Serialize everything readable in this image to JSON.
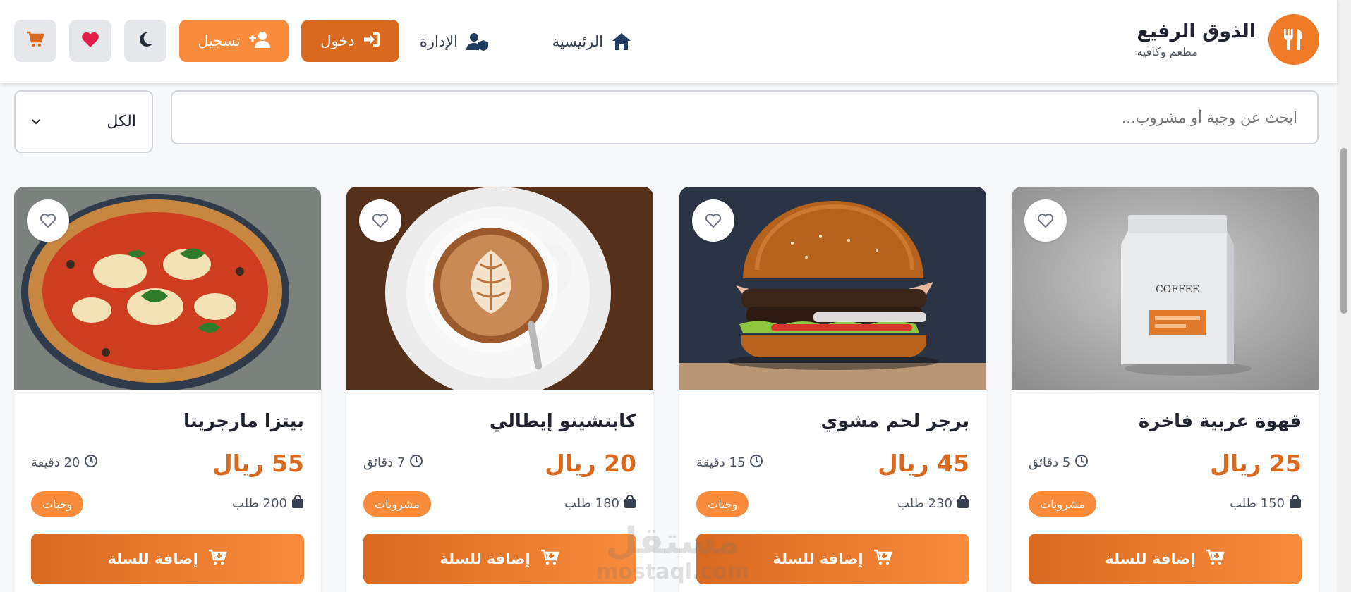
{
  "header": {
    "brand_title": "الذوق الرفيع",
    "brand_subtitle": "مطعم وكافيه",
    "nav": {
      "home": "الرئيسية",
      "admin": "الإدارة"
    },
    "login_label": "دخول",
    "register_label": "تسجيل",
    "icons": [
      "utensils-icon",
      "home-icon",
      "user-shield-icon",
      "sign-in-icon",
      "user-plus-icon",
      "moon-icon",
      "heart-icon",
      "cart-icon"
    ]
  },
  "search": {
    "placeholder": "ابحث عن وجبة أو مشروب...",
    "category_selected": "الكل"
  },
  "colors": {
    "accent": "#f07a25",
    "accent_dark": "#d9691f",
    "accent_light": "#f98b3c",
    "favorite": "#e11d48"
  },
  "products": [
    {
      "name": "قهوة عربية فاخرة",
      "price": "25 ريال",
      "time": "5 دقائق",
      "orders": "150 طلب",
      "category": "مشروبات",
      "button": "إضافة للسلة",
      "image": "coffee-bag"
    },
    {
      "name": "برجر لحم مشوي",
      "price": "45 ريال",
      "time": "15 دقيقة",
      "orders": "230 طلب",
      "category": "وجبات",
      "button": "إضافة للسلة",
      "image": "burger"
    },
    {
      "name": "كابتشينو إيطالي",
      "price": "20 ريال",
      "time": "7 دقائق",
      "orders": "180 طلب",
      "category": "مشروبات",
      "button": "إضافة للسلة",
      "image": "cappuccino"
    },
    {
      "name": "بيتزا مارجريتا",
      "price": "55 ريال",
      "time": "20 دقيقة",
      "orders": "200 طلب",
      "category": "وجبات",
      "button": "إضافة للسلة",
      "image": "pizza"
    }
  ],
  "watermark": {
    "arabic": "مستقل",
    "latin": "mostaql.com"
  }
}
